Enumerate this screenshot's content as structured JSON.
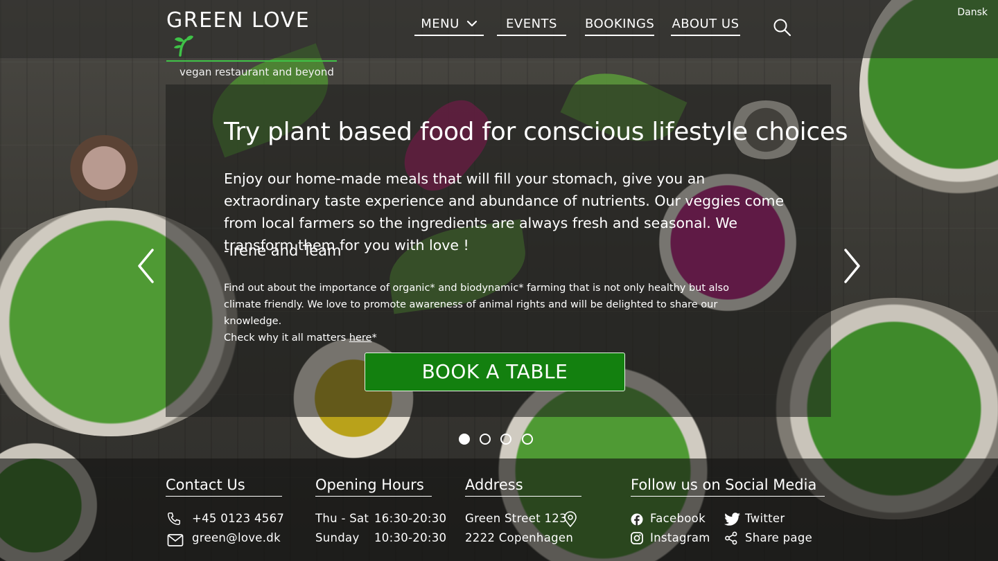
{
  "header": {
    "logo_text": "GREEN LOVE",
    "tagline": "vegan restaurant and beyond",
    "nav": {
      "menu": "MENU",
      "events": "EVENTS",
      "bookings": "BOOKINGS",
      "about": "ABOUT US"
    },
    "language": "Dansk"
  },
  "hero": {
    "title": "Try plant based food for conscious lifestyle choices",
    "body": "Enjoy our home-made meals that will fill your stomach, give you an extraordinary taste experience and abundance of nutrients.  Our veggies come from local farmers so the ingredients are always fresh and seasonal. We transform them for you with love !",
    "signature": "-Irene and Team",
    "small_line1": "Find out about the importance of organic* and biodynamic* farming that is not only healthy but also climate friendly. We love to promote awareness of animal rights and will be delighted to share our knowledge.",
    "small_line2_prefix": "Check why it all matters ",
    "small_link": "here",
    "small_line2_suffix": "*",
    "cta": "BOOK A TABLE"
  },
  "carousel": {
    "slides": 4,
    "active_index": 0
  },
  "footer": {
    "contact": {
      "heading": "Contact  Us",
      "phone": "+45 0123 4567",
      "email": "green@love.dk"
    },
    "hours": {
      "heading": "Opening Hours",
      "rows": [
        {
          "days": "Thu - Sat",
          "time": "16:30-20:30"
        },
        {
          "days": "Sunday",
          "time": "10:30-20:30"
        }
      ]
    },
    "address": {
      "heading": "Address",
      "street": "Green Street 123",
      "city": "2222 Copenhagen"
    },
    "social": {
      "heading": "Follow us on Social Media",
      "facebook": "Facebook",
      "twitter": "Twitter",
      "instagram": "Instagram",
      "share": "Share page"
    }
  },
  "colors": {
    "brand_green": "#13800f",
    "logo_accent": "#3fc247"
  },
  "icons": [
    "logo-sprout-icon",
    "chevron-down-icon",
    "search-icon",
    "chevron-left-icon",
    "chevron-right-icon",
    "phone-icon",
    "mail-icon",
    "location-pin-icon",
    "facebook-icon",
    "twitter-icon",
    "instagram-icon",
    "share-icon"
  ]
}
